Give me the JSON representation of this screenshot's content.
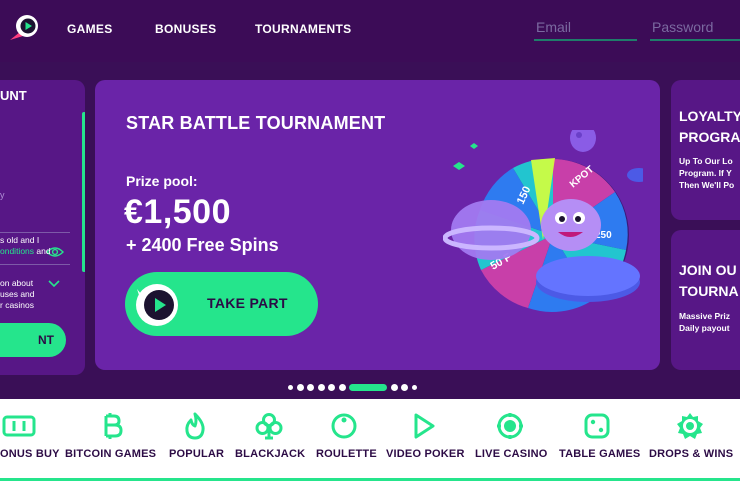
{
  "header": {
    "nav": [
      "GAMES",
      "BONUSES",
      "TOURNAMENTS"
    ],
    "email_placeholder": "Email",
    "password_placeholder": "Password"
  },
  "account_panel": {
    "title": "UNT",
    "label": "y",
    "terms_line1": "s old and I",
    "terms_line2": "onditions",
    "terms_line2_tail": " and",
    "promo_line1": "on about",
    "promo_line2": "uses and",
    "promo_line3": "r casinos",
    "button": "NT"
  },
  "hero": {
    "title": "STAR BATTLE TOURNAMENT",
    "prize_label": "Prize pool:",
    "amount": "€1,500",
    "spins": "+ 2400 Free Spins",
    "button": "TAKE PART",
    "wheel_labels": [
      "150",
      "KPOT",
      "250",
      "50 F"
    ]
  },
  "loyalty_card": {
    "title": "LOYALTY\nPROGRA",
    "text": "Up To Our Lo\nProgram. If Y\nThen We'll Po"
  },
  "join_card": {
    "title": "JOIN OU\nTOURNA",
    "text": "Massive Priz\nDaily payout"
  },
  "carousel": {
    "slide_count": 10,
    "active_index": 5
  },
  "categories": [
    {
      "label": "ONUS BUY",
      "icon": "bonus-buy-icon"
    },
    {
      "label": "BITCOIN GAMES",
      "icon": "bitcoin-icon"
    },
    {
      "label": "POPULAR",
      "icon": "flame-icon"
    },
    {
      "label": "BLACKJACK",
      "icon": "club-icon"
    },
    {
      "label": "ROULETTE",
      "icon": "roulette-icon"
    },
    {
      "label": "VIDEO POKER",
      "icon": "play-icon"
    },
    {
      "label": "LIVE CASINO",
      "icon": "live-icon"
    },
    {
      "label": "TABLE GAMES",
      "icon": "dice-icon"
    },
    {
      "label": "DROPS & WINS",
      "icon": "drops-wins-icon"
    }
  ],
  "colors": {
    "background": "#3a0f57",
    "panel": "#571786",
    "hero": "#6a24a8",
    "accent": "#25e58c",
    "category_text": "#2c0b45"
  }
}
